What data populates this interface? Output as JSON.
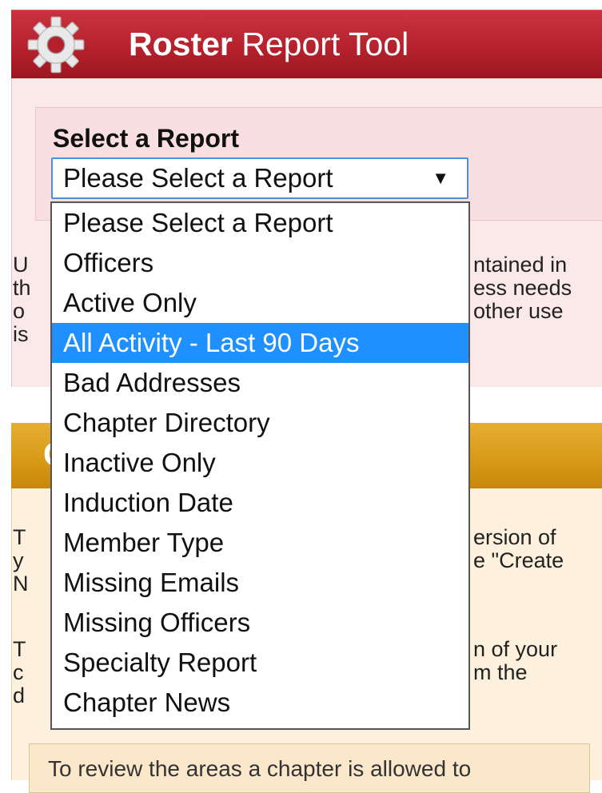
{
  "header": {
    "title_bold": "Roster",
    "title_rest": " Report Tool",
    "icon": "gear-icon",
    "color": "#b3202b"
  },
  "report_panel": {
    "select_label": "Select a Report",
    "select_value": "Please Select a Report",
    "arrow": "▼",
    "partial_text_left": [
      "U",
      "th",
      "o",
      "is"
    ],
    "partial_text_right": [
      "ntained in",
      "ess needs",
      "other use"
    ]
  },
  "dropdown": {
    "options": [
      "Please Select a Report",
      "Officers",
      "Active Only",
      "All Activity - Last 90 Days",
      "Bad Addresses",
      "Chapter Directory",
      "Inactive Only",
      "Induction Date",
      "Member Type",
      "Missing Emails",
      "Missing Officers",
      "Specialty Report",
      "Chapter News"
    ],
    "highlighted": "All Activity - Last 90 Days",
    "highlight_color": "#1e90ff"
  },
  "gold_panel": {
    "header_partial": "C",
    "color": "#d99a17",
    "partial_text_left": [
      "T",
      "y",
      "N",
      "T",
      "c",
      "d"
    ],
    "partial_text_right": [
      "ersion of",
      "e \"Create",
      "n of your",
      "m the"
    ],
    "bottom_text": "To review the areas a chapter is allowed to"
  }
}
